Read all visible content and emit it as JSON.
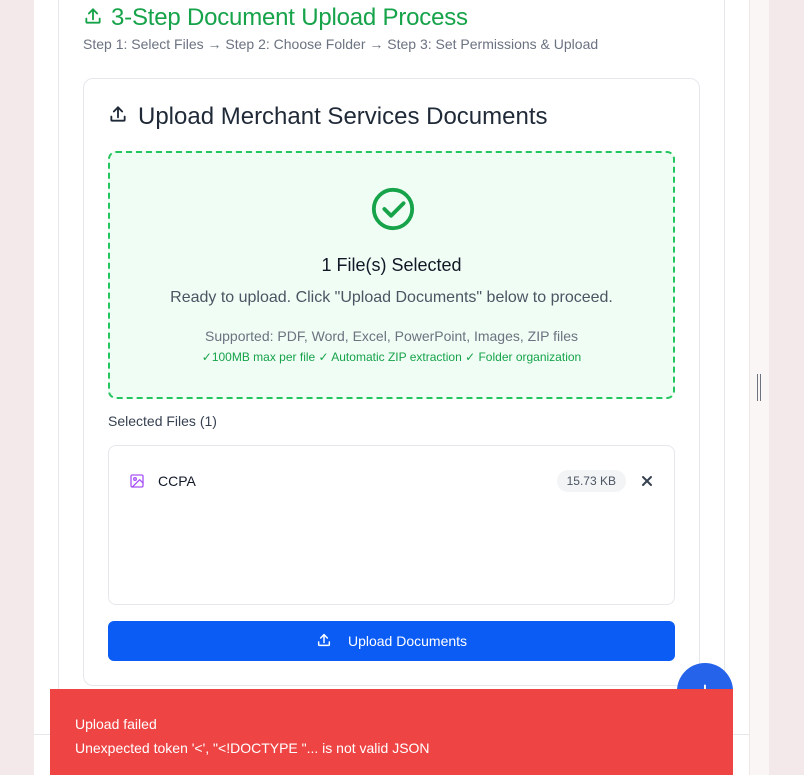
{
  "header": {
    "title": "3-Step Document Upload Process",
    "steps": "Step 1: Select Files → Step 2: Choose Folder → Step 3: Set Permissions & Upload"
  },
  "upload_card": {
    "title": "Upload Merchant Services Documents"
  },
  "dropzone": {
    "status_title": "1 File(s) Selected",
    "status_desc": "Ready to upload. Click \"Upload Documents\" below to proceed.",
    "supported": "Supported: PDF, Word, Excel, PowerPoint, Images, ZIP files",
    "features": "✓100MB max per file ✓ Automatic ZIP extraction ✓ Folder organization"
  },
  "files": {
    "label": "Selected Files (1)",
    "items": [
      {
        "name": "CCPA",
        "size": "15.73 KB",
        "icon": "image-icon"
      }
    ]
  },
  "actions": {
    "upload_label": "Upload Documents"
  },
  "fab": {
    "label": "+"
  },
  "toast": {
    "title": "Upload failed",
    "message": "Unexpected token '<', \"<!DOCTYPE \"... is not valid JSON"
  },
  "colors": {
    "success": "#16a34a",
    "primary": "#0b5cf5",
    "error": "#ef4444",
    "file_icon": "#a855f7"
  }
}
